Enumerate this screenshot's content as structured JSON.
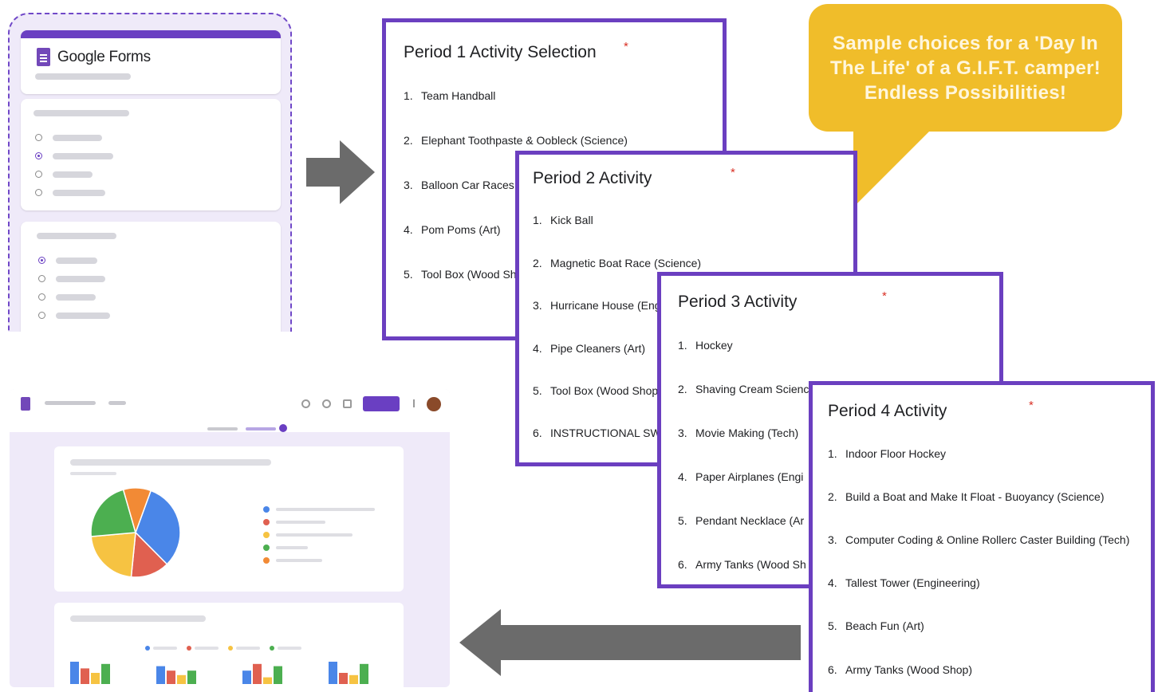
{
  "forms_mock": {
    "brand": "Google Forms",
    "accent": "#6a3fc2"
  },
  "callout": {
    "lines": [
      "Sample choices for a 'Day In",
      "The Life' of a G.I.F.T. camper!",
      "Endless Possibilities!"
    ],
    "color": "#f0bd2a"
  },
  "panels": [
    {
      "title": "Period 1 Activity Selection",
      "required": "*",
      "items": [
        {
          "num": "1.",
          "text": "Team Handball"
        },
        {
          "num": "2.",
          "text": "Elephant Toothpaste & Oobleck (Science)"
        },
        {
          "num": "3.",
          "text": "Balloon Car Races"
        },
        {
          "num": "4.",
          "text": "Pom Poms  (Art)"
        },
        {
          "num": "5.",
          "text": "Tool Box (Wood Sh"
        }
      ]
    },
    {
      "title": "Period 2 Activity",
      "required": "*",
      "items": [
        {
          "num": "1.",
          "text": "Kick Ball"
        },
        {
          "num": "2.",
          "text": "Magnetic Boat Race  (Science)"
        },
        {
          "num": "3.",
          "text": "Hurricane House (Eng"
        },
        {
          "num": "4.",
          "text": "Pipe Cleaners (Art)"
        },
        {
          "num": "5.",
          "text": "Tool Box (Wood Shop"
        },
        {
          "num": "6.",
          "text": "INSTRUCTIONAL SW"
        }
      ]
    },
    {
      "title": "Period 3 Activity",
      "required": "*",
      "items": [
        {
          "num": "1.",
          "text": "Hockey"
        },
        {
          "num": "2.",
          "text": "Shaving Cream Scienc"
        },
        {
          "num": "3.",
          "text": "Movie Making (Tech)"
        },
        {
          "num": "4.",
          "text": "Paper Airplanes (Engi"
        },
        {
          "num": "5.",
          "text": "Pendant Necklace (Ar"
        },
        {
          "num": "6.",
          "text": "Army Tanks (Wood Sh"
        }
      ]
    },
    {
      "title": "Period 4 Activity",
      "required": "*",
      "items": [
        {
          "num": "1.",
          "text": "Indoor Floor Hockey"
        },
        {
          "num": "2.",
          "text": "Build a Boat and Make It Float - Buoyancy  (Science)"
        },
        {
          "num": "3.",
          "text": "Computer Coding & Online Rollerc Caster Building (Tech)"
        },
        {
          "num": "4.",
          "text": "Tallest Tower (Engineering)"
        },
        {
          "num": "5.",
          "text": "Beach Fun (Art)"
        },
        {
          "num": "6.",
          "text": "Army Tanks (Wood Shop)"
        }
      ]
    }
  ],
  "responses_mock": {
    "pie_slices": [
      {
        "color": "#4a86e8",
        "fraction": 0.32
      },
      {
        "color": "#e06050",
        "fraction": 0.14
      },
      {
        "color": "#f6c342",
        "fraction": 0.22
      },
      {
        "color": "#4caf50",
        "fraction": 0.22
      },
      {
        "color": "#f28a35",
        "fraction": 0.1
      }
    ],
    "legend_colors": [
      "#4a86e8",
      "#e06050",
      "#f6c342",
      "#4caf50",
      "#f28a35"
    ],
    "bar_groups": [
      [
        1.0,
        0.7,
        0.5,
        0.9
      ],
      [
        0.8,
        0.6,
        0.4,
        0.6
      ],
      [
        0.6,
        0.9,
        0.3,
        0.8
      ],
      [
        1.0,
        0.5,
        0.4,
        0.9
      ]
    ],
    "bar_colors": [
      "#4a86e8",
      "#e06050",
      "#f6c342",
      "#4caf50"
    ]
  }
}
